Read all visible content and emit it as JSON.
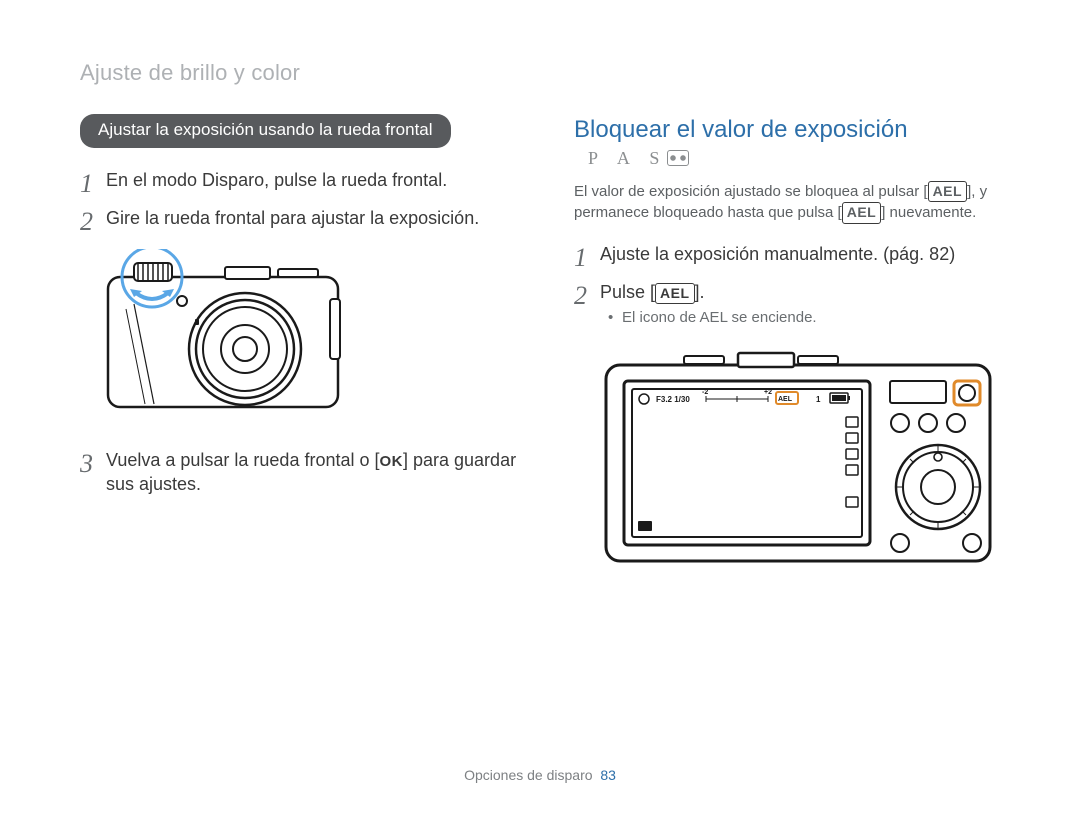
{
  "section_title": "Ajuste de brillo y color",
  "left": {
    "pill": "Ajustar la exposición usando la rueda frontal",
    "step1": "En el modo Disparo, pulse la rueda frontal.",
    "step2": "Gire la rueda frontal para ajustar la exposición.",
    "step3_pre": "Vuelva a pulsar la rueda frontal o [",
    "step3_ok": "OK",
    "step3_post": "] para guardar sus ajustes."
  },
  "right": {
    "heading": "Bloquear el valor de exposición",
    "modes": "P A S",
    "intro_pre": "El valor de exposición ajustado se bloquea al pulsar [",
    "intro_mid": "], y permanece bloqueado hasta que pulsa [",
    "intro_post": "] nuevamente.",
    "ael": "AEL",
    "step1": "Ajuste la exposición manualmente. (pág. 82)",
    "step2_pre": "Pulse [",
    "step2_post": "].",
    "bullet1": "El icono de AEL se enciende.",
    "lcd_text": "F3.2 1/30"
  },
  "footer": {
    "label": "Opciones de disparo",
    "page": "83"
  }
}
